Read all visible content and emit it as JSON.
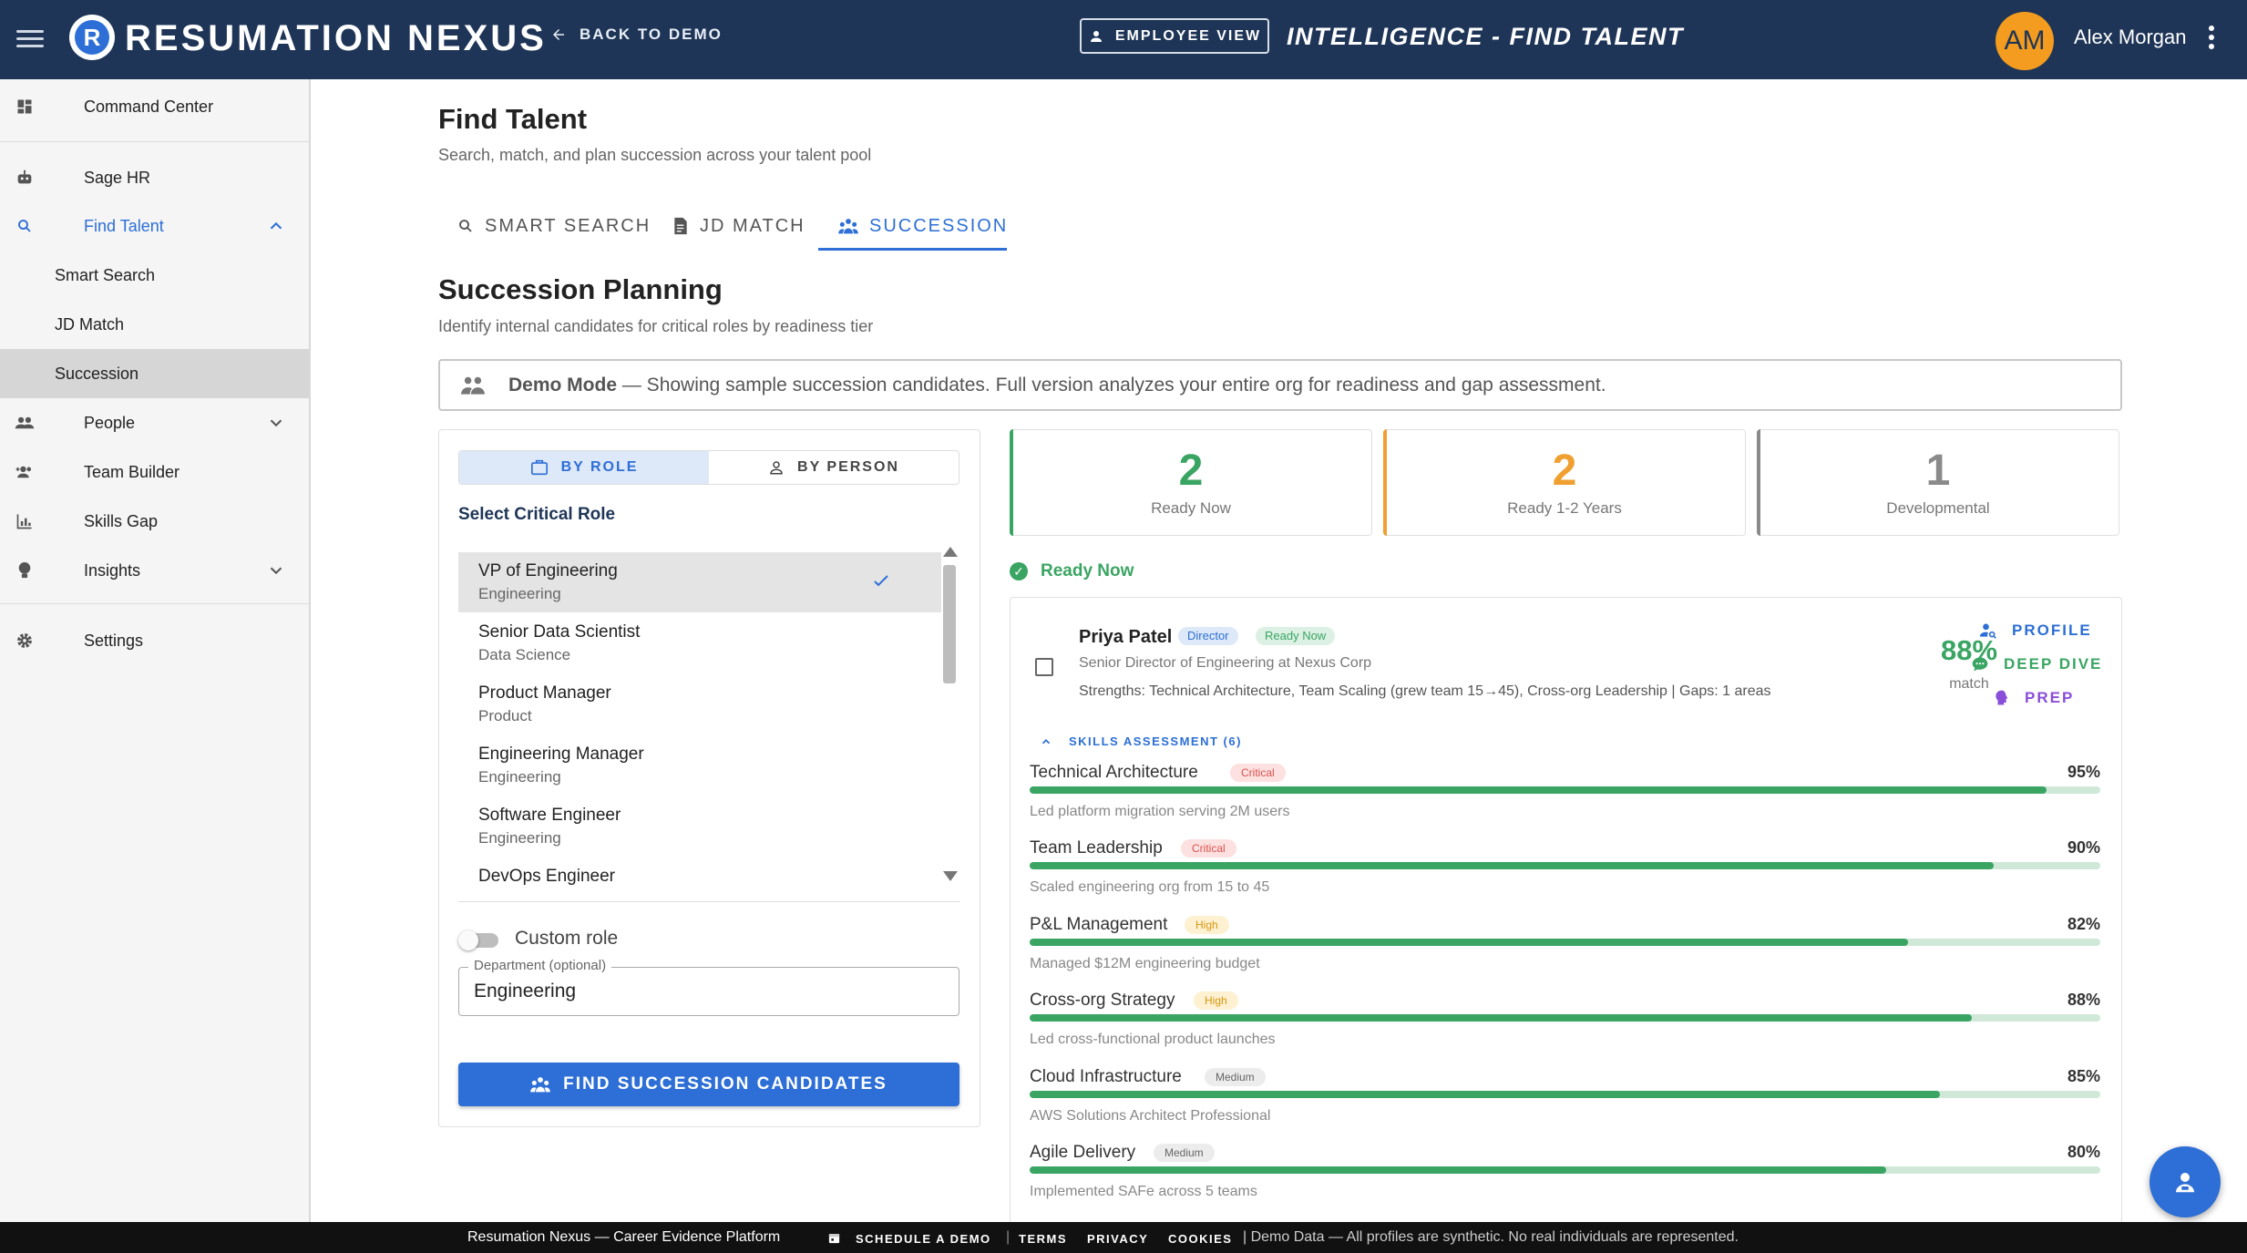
{
  "header": {
    "logo_letter": "R",
    "brand": "RESUMATION NEXUS",
    "back_label": "BACK TO DEMO",
    "employee_view": "EMPLOYEE VIEW",
    "page_label": "INTELLIGENCE - FIND TALENT",
    "avatar_initials": "AM",
    "user_name": "Alex Morgan"
  },
  "sidebar": {
    "items": [
      {
        "label": "Command Center",
        "icon": "dashboard-icon"
      },
      {
        "label": "Sage HR",
        "icon": "robot-icon"
      },
      {
        "label": "Find Talent",
        "icon": "search-icon"
      },
      {
        "label": "Smart Search"
      },
      {
        "label": "JD Match"
      },
      {
        "label": "Succession"
      },
      {
        "label": "People",
        "icon": "people-icon"
      },
      {
        "label": "Team Builder",
        "icon": "group-add-icon"
      },
      {
        "label": "Skills Gap",
        "icon": "chart-icon"
      },
      {
        "label": "Insights",
        "icon": "lightbulb-icon"
      },
      {
        "label": "Settings",
        "icon": "gear-icon"
      }
    ]
  },
  "main": {
    "title": "Find Talent",
    "subtitle": "Search, match, and plan succession across your talent pool",
    "tabs": [
      {
        "label": "SMART SEARCH"
      },
      {
        "label": "JD MATCH"
      },
      {
        "label": "SUCCESSION"
      }
    ],
    "section_title": "Succession Planning",
    "section_subtitle": "Identify internal candidates for critical roles by readiness tier",
    "demo_bold": "Demo Mode",
    "demo_text": " — Showing sample succession candidates. Full version analyzes your entire org for readiness and gap assessment."
  },
  "panel": {
    "by_role": "BY ROLE",
    "by_person": "BY PERSON",
    "select_label": "Select Critical Role",
    "roles": [
      {
        "title": "VP of Engineering",
        "dept": "Engineering"
      },
      {
        "title": "Senior Data Scientist",
        "dept": "Data Science"
      },
      {
        "title": "Product Manager",
        "dept": "Product"
      },
      {
        "title": "Engineering Manager",
        "dept": "Engineering"
      },
      {
        "title": "Software Engineer",
        "dept": "Engineering"
      },
      {
        "title": "DevOps Engineer",
        "dept": ""
      }
    ],
    "custom_role_label": "Custom role",
    "dept_label": "Department (optional)",
    "dept_value": "Engineering",
    "find_button": "FIND SUCCESSION CANDIDATES"
  },
  "stats": [
    {
      "value": "2",
      "label": "Ready Now",
      "color": "#3aa563"
    },
    {
      "value": "2",
      "label": "Ready 1-2 Years",
      "color": "#f0a030"
    },
    {
      "value": "1",
      "label": "Developmental",
      "color": "#8a8a8a"
    }
  ],
  "tier_heading": "Ready Now",
  "candidate": {
    "name": "Priya Patel",
    "level_chip": "Director",
    "status_chip": "Ready Now",
    "title": "Senior Director of Engineering at Nexus Corp",
    "strengths": "Strengths: Technical Architecture, Team Scaling (grew team 15→45), Cross-org Leadership | Gaps: 1 areas",
    "match_pct": "88%",
    "match_label": "match",
    "actions": {
      "profile": "PROFILE",
      "deep_dive": "DEEP DIVE",
      "prep": "PREP"
    },
    "skills_label": "SKILLS ASSESSMENT (6)",
    "skills": [
      {
        "name": "Technical Architecture",
        "level": "Critical",
        "pct": 95,
        "pct_label": "95%",
        "evidence": "Led platform migration serving 2M users"
      },
      {
        "name": "Team Leadership",
        "level": "Critical",
        "pct": 90,
        "pct_label": "90%",
        "evidence": "Scaled engineering org from 15 to 45"
      },
      {
        "name": "P&L Management",
        "level": "High",
        "pct": 82,
        "pct_label": "82%",
        "evidence": "Managed $12M engineering budget"
      },
      {
        "name": "Cross-org Strategy",
        "level": "High",
        "pct": 88,
        "pct_label": "88%",
        "evidence": "Led cross-functional product launches"
      },
      {
        "name": "Cloud Infrastructure",
        "level": "Medium",
        "pct": 85,
        "pct_label": "85%",
        "evidence": "AWS Solutions Architect Professional"
      },
      {
        "name": "Agile Delivery",
        "level": "Medium",
        "pct": 80,
        "pct_label": "80%",
        "evidence": "Implemented SAFe across 5 teams"
      }
    ]
  },
  "footer": {
    "platform": "Resumation Nexus — Career Evidence Platform",
    "schedule": "SCHEDULE A DEMO",
    "terms": "TERMS",
    "privacy": "PRIVACY",
    "cookies": "COOKIES",
    "disclaimer": "| Demo Data — All profiles are synthetic. No real individuals are represented."
  }
}
